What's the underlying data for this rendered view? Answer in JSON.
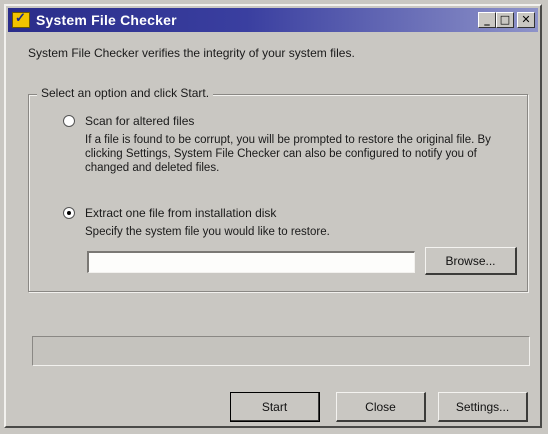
{
  "window": {
    "title": "System File Checker",
    "minimize_glyph": "_",
    "maximize_glyph": "□",
    "close_glyph": "✕",
    "icon": "checkmark-app-icon"
  },
  "description": "System File Checker verifies the integrity of your system files.",
  "group": {
    "label": "Select an option and click Start.",
    "option_scan": {
      "label": "Scan for altered files",
      "checked": false,
      "help": "If a file is found to be corrupt, you will be prompted to restore the original file. By clicking Settings, System File Checker can also be configured to notify you of changed and deleted files."
    },
    "option_extract": {
      "label": "Extract one file from installation disk",
      "checked": true,
      "help": "Specify the system file you would like to restore.",
      "file_value": "",
      "browse_label": "Browse..."
    }
  },
  "buttons": {
    "start": "Start",
    "close": "Close",
    "settings": "Settings..."
  },
  "colors": {
    "titlebar_start": "#2a2d8a",
    "titlebar_end": "#8e93c9",
    "face": "#c9c7c2"
  }
}
